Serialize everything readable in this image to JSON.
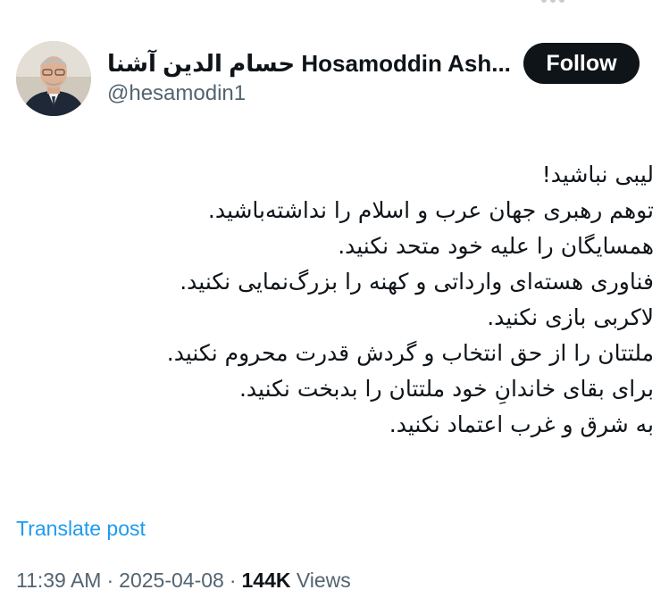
{
  "author": {
    "display_name": "حسام الدین آشنا Hosamoddin Ash...",
    "handle": "@hesamodin1"
  },
  "follow_label": "Follow",
  "tweet": {
    "lines": [
      "لیبی نباشید!",
      "توهم رهبری جهان عرب و اسلام را نداشته‌باشید.",
      "همسایگان را علیه خود متحد نکنید.",
      "فناوری هسته‌ای وارداتی و کهنه را بزرگ‌نمایی نکنید.",
      "لاکربی بازی نکنید.",
      "ملتتان را از حق انتخاب و گردش قدرت محروم نکنید.",
      "برای بقای خاندانِ خود ملتتان را بدبخت نکنید.",
      "به شرق و غرب اعتماد نکنید."
    ]
  },
  "translate_label": "Translate post",
  "meta": {
    "time": "11:39 AM",
    "separator": "·",
    "date": "2025-04-08",
    "views_count": "144K",
    "views_label": "Views"
  },
  "icons": {
    "avatar": "profile-photo"
  },
  "colors": {
    "text": "#0f1419",
    "secondary": "#536471",
    "link": "#1d9bf0",
    "follow_bg": "#0f1419"
  }
}
